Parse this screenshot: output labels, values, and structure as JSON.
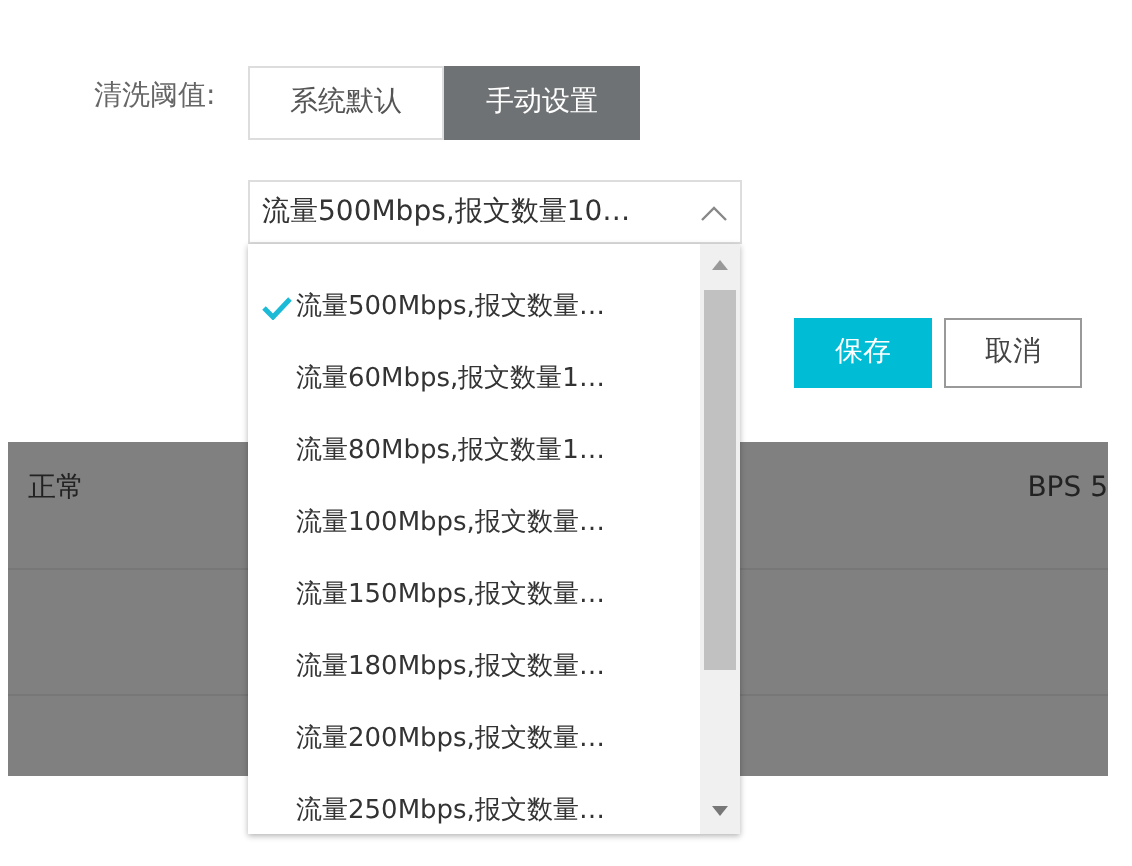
{
  "field_label": "清洗阈值:",
  "mode_tabs": [
    {
      "label": "系统默认",
      "selected": false
    },
    {
      "label": "手动设置",
      "selected": true
    }
  ],
  "threshold_select": {
    "value": "流量500Mbps,报文数量10…",
    "expanded": true,
    "options": [
      {
        "label": "流量500Mbps,报文数量…",
        "selected": true
      },
      {
        "label": "流量60Mbps,报文数量1…",
        "selected": false
      },
      {
        "label": "流量80Mbps,报文数量1…",
        "selected": false
      },
      {
        "label": "流量100Mbps,报文数量…",
        "selected": false
      },
      {
        "label": "流量150Mbps,报文数量…",
        "selected": false
      },
      {
        "label": "流量180Mbps,报文数量…",
        "selected": false
      },
      {
        "label": "流量200Mbps,报文数量…",
        "selected": false
      },
      {
        "label": "流量250Mbps,报文数量…",
        "selected": false
      }
    ]
  },
  "buttons": [
    {
      "label": "保存",
      "kind": "primary"
    },
    {
      "label": "取消",
      "kind": "secondary"
    }
  ],
  "background_table": {
    "status": "正常",
    "column_3": "BPS 5"
  }
}
